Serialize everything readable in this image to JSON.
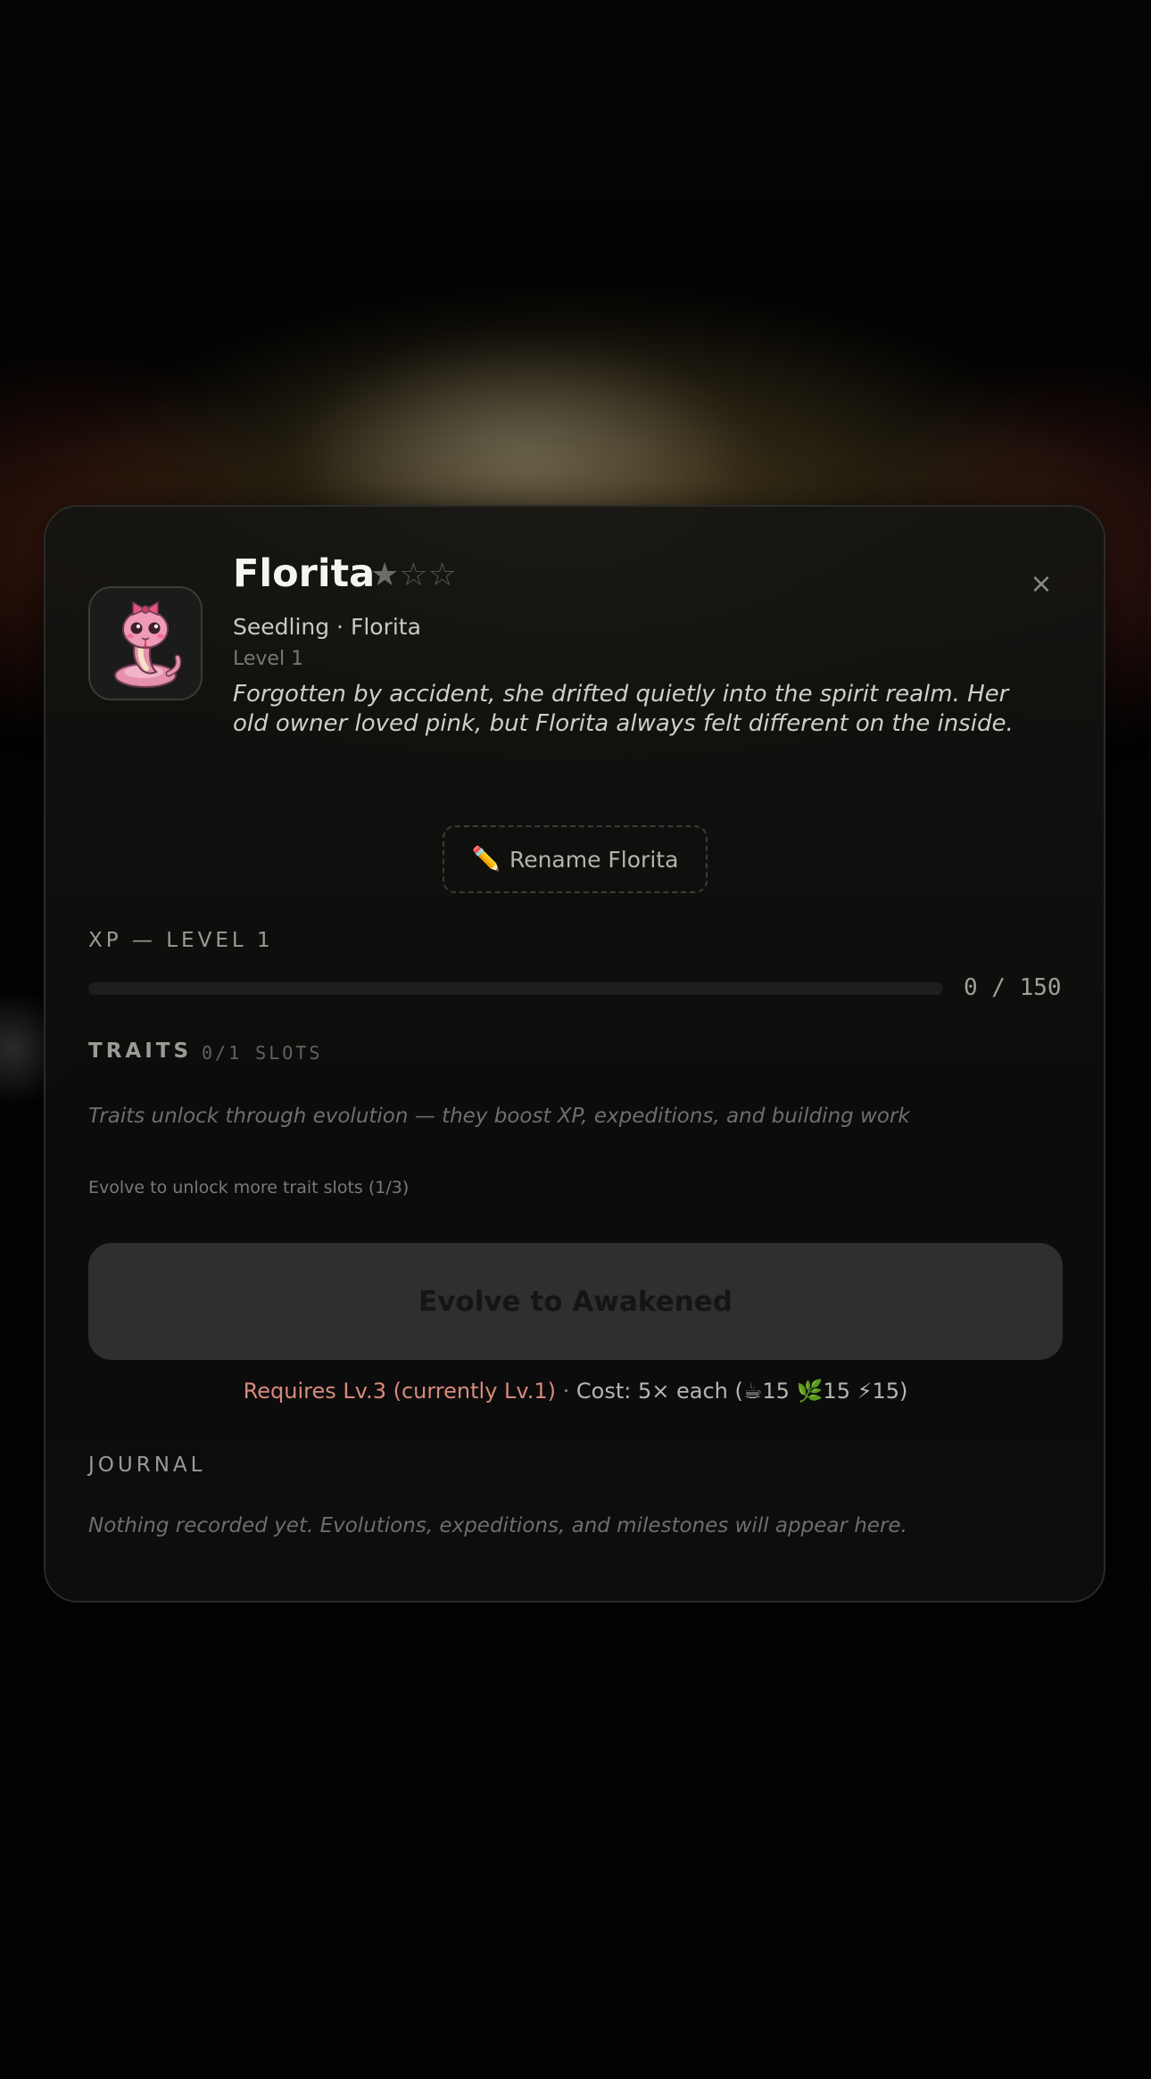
{
  "pet": {
    "name": "Florita",
    "stars": {
      "filled": "★",
      "empty": "☆☆",
      "rating": 1,
      "max": 3
    },
    "subtitle": "Seedling · Florita",
    "level_label": "Level 1",
    "bio": "Forgotten by accident, she drifted quietly into the spirit realm. Her old owner loved pink, but Florita always felt different on the inside.",
    "avatar_icon": "pink-snake-with-bow-icon"
  },
  "actions": {
    "close_symbol": "×",
    "rename_icon": "✏️",
    "rename_label": "Rename Florita"
  },
  "xp": {
    "title": "XP — LEVEL 1",
    "current": 0,
    "max": 150,
    "display": "0 / 150"
  },
  "traits": {
    "title": "TRAITS",
    "slots": "0/1 SLOTS",
    "empty_note": "Traits unlock through evolution — they boost XP, expeditions, and building work",
    "unlock_hint": "Evolve to unlock more trait slots (1/3)"
  },
  "evolve": {
    "button_label": "Evolve to Awakened",
    "requirement": "Requires Lv.3 (currently Lv.1)",
    "separator": " · ",
    "cost": "Cost: 5× each (☕15 🌿15 ⚡15)"
  },
  "journal": {
    "title": "JOURNAL",
    "empty_note": "Nothing recorded yet. Evolutions, expeditions, and milestones will appear here."
  },
  "colors": {
    "background": "#030303",
    "card": "#141412",
    "accent_warning": "#d98a7c",
    "button_disabled": "#2f2f2f"
  }
}
